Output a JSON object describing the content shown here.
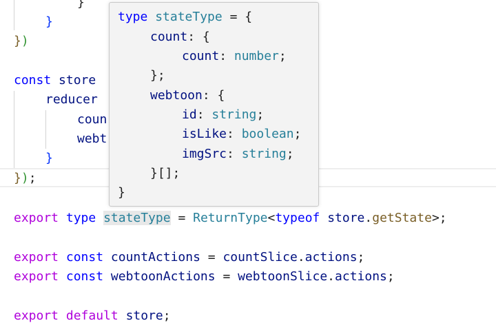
{
  "editor": {
    "lines": [
      {
        "tokens": [
          {
            "t": "}",
            "c": "plain"
          }
        ]
      },
      {
        "tokens": [
          {
            "t": "}",
            "c": "bracket-b"
          }
        ]
      },
      {
        "tokens": [
          {
            "t": "}",
            "c": "bracket-y"
          },
          {
            "t": ")",
            "c": "bracket-g"
          }
        ]
      },
      {
        "tokens": [
          {
            "t": "const",
            "c": "kw"
          },
          {
            "t": " store",
            "c": "var"
          }
        ]
      },
      {
        "tokens": [
          {
            "t": "reducer",
            "c": "var"
          }
        ]
      },
      {
        "tokens": [
          {
            "t": "coun",
            "c": "var"
          }
        ]
      },
      {
        "tokens": [
          {
            "t": "webt",
            "c": "var"
          }
        ]
      },
      {
        "tokens": [
          {
            "t": "}",
            "c": "bracket-b"
          }
        ]
      },
      {
        "tokens": [
          {
            "t": "}",
            "c": "bracket-y"
          },
          {
            "t": ")",
            "c": "bracket-g"
          },
          {
            "t": ";",
            "c": "plain"
          }
        ]
      },
      {
        "tokens": [
          {
            "t": "export",
            "c": "kw-ctrl"
          },
          {
            "t": " type ",
            "c": "kw"
          },
          {
            "t": "stateType",
            "c": "type"
          },
          {
            "t": " = ",
            "c": "plain"
          },
          {
            "t": "ReturnType",
            "c": "type"
          },
          {
            "t": "<",
            "c": "plain"
          },
          {
            "t": "typeof",
            "c": "kw"
          },
          {
            "t": " store",
            "c": "var"
          },
          {
            "t": ".",
            "c": "plain"
          },
          {
            "t": "getState",
            "c": "fn"
          },
          {
            "t": ">;",
            "c": "plain"
          }
        ]
      },
      {
        "tokens": [
          {
            "t": "export",
            "c": "kw-ctrl"
          },
          {
            "t": " const ",
            "c": "kw"
          },
          {
            "t": "countActions",
            "c": "var"
          },
          {
            "t": " = ",
            "c": "plain"
          },
          {
            "t": "countSlice",
            "c": "var"
          },
          {
            "t": ".",
            "c": "plain"
          },
          {
            "t": "actions",
            "c": "var"
          },
          {
            "t": ";",
            "c": "plain"
          }
        ]
      },
      {
        "tokens": [
          {
            "t": "export",
            "c": "kw-ctrl"
          },
          {
            "t": " const ",
            "c": "kw"
          },
          {
            "t": "webtoonActions",
            "c": "var"
          },
          {
            "t": " = ",
            "c": "plain"
          },
          {
            "t": "webtoonSlice",
            "c": "var"
          },
          {
            "t": ".",
            "c": "plain"
          },
          {
            "t": "actions",
            "c": "var"
          },
          {
            "t": ";",
            "c": "plain"
          }
        ]
      },
      {
        "tokens": [
          {
            "t": "export",
            "c": "kw-ctrl"
          },
          {
            "t": " default ",
            "c": "kw-ctrl"
          },
          {
            "t": "store",
            "c": "var"
          },
          {
            "t": ";",
            "c": "plain"
          }
        ]
      }
    ]
  },
  "hover": {
    "lines": [
      {
        "tokens": [
          {
            "t": "type",
            "c": "kw"
          },
          {
            "t": " stateType",
            "c": "type"
          },
          {
            "t": " = {",
            "c": "plain"
          }
        ]
      },
      {
        "tokens": [
          {
            "t": "count",
            "c": "var"
          },
          {
            "t": ": {",
            "c": "plain"
          }
        ]
      },
      {
        "tokens": [
          {
            "t": "count",
            "c": "var"
          },
          {
            "t": ": ",
            "c": "plain"
          },
          {
            "t": "number",
            "c": "type"
          },
          {
            "t": ";",
            "c": "plain"
          }
        ]
      },
      {
        "tokens": [
          {
            "t": "};",
            "c": "plain"
          }
        ]
      },
      {
        "tokens": [
          {
            "t": "webtoon",
            "c": "var"
          },
          {
            "t": ": {",
            "c": "plain"
          }
        ]
      },
      {
        "tokens": [
          {
            "t": "id",
            "c": "var"
          },
          {
            "t": ": ",
            "c": "plain"
          },
          {
            "t": "string",
            "c": "type"
          },
          {
            "t": ";",
            "c": "plain"
          }
        ]
      },
      {
        "tokens": [
          {
            "t": "isLike",
            "c": "var"
          },
          {
            "t": ": ",
            "c": "plain"
          },
          {
            "t": "boolean",
            "c": "type"
          },
          {
            "t": ";",
            "c": "plain"
          }
        ]
      },
      {
        "tokens": [
          {
            "t": "imgSrc",
            "c": "var"
          },
          {
            "t": ": ",
            "c": "plain"
          },
          {
            "t": "string",
            "c": "type"
          },
          {
            "t": ";",
            "c": "plain"
          }
        ]
      },
      {
        "tokens": [
          {
            "t": "}[];",
            "c": "plain"
          }
        ]
      },
      {
        "tokens": [
          {
            "t": "}",
            "c": "plain"
          }
        ]
      }
    ]
  }
}
